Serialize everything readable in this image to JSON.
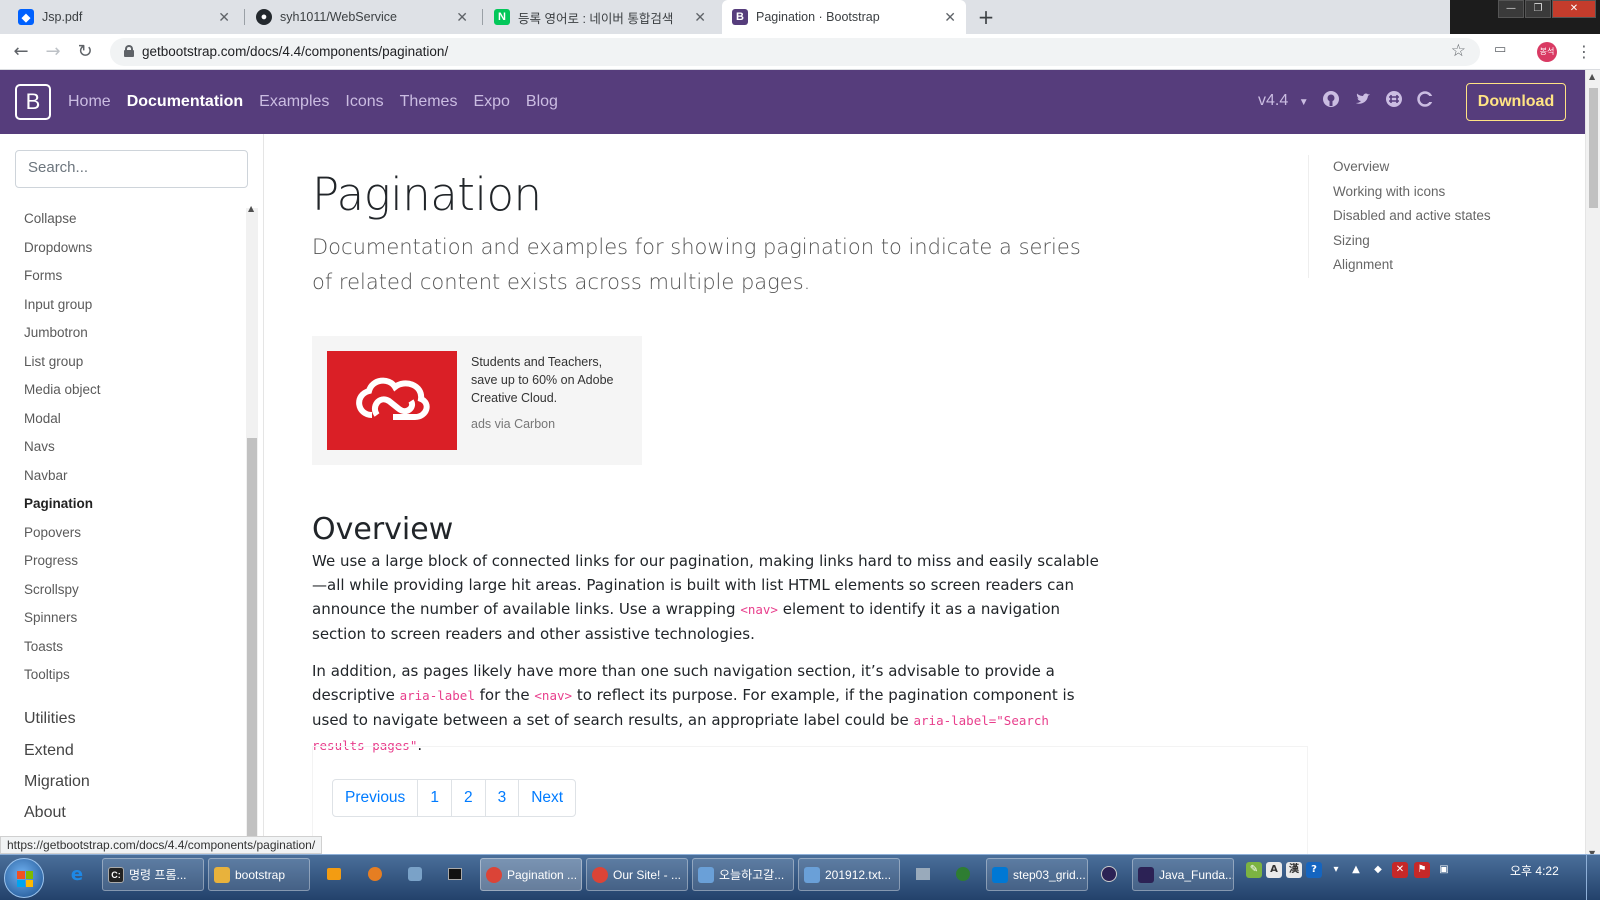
{
  "browser": {
    "tabs": [
      {
        "title": "Jsp.pdf",
        "icon": "dropbox-icon",
        "color": "#0061fe"
      },
      {
        "title": "syh1011/WebService",
        "icon": "github-icon",
        "color": "#24292e"
      },
      {
        "title": "등록 영어로 : 네이버 통합검색",
        "icon": "naver-icon",
        "color": "#03c75a"
      },
      {
        "title": "Pagination · Bootstrap",
        "icon": "bootstrap-icon",
        "color": "#563d7c"
      }
    ],
    "address": "getbootstrap.com/docs/4.4/components/pagination/",
    "profile_initials": "봉석",
    "status_url": "https://getbootstrap.com/docs/4.4/components/pagination/"
  },
  "header": {
    "brand": "B",
    "nav": [
      "Home",
      "Documentation",
      "Examples",
      "Icons",
      "Themes",
      "Expo",
      "Blog"
    ],
    "active_nav": "Documentation",
    "version": "v4.4",
    "download": "Download",
    "brand_color": "#563d7c",
    "download_color": "#ffe484"
  },
  "sidebar": {
    "search_placeholder": "Search...",
    "items": [
      "Collapse",
      "Dropdowns",
      "Forms",
      "Input group",
      "Jumbotron",
      "List group",
      "Media object",
      "Modal",
      "Navs",
      "Navbar",
      "Pagination",
      "Popovers",
      "Progress",
      "Scrollspy",
      "Spinners",
      "Toasts",
      "Tooltips"
    ],
    "active_item": "Pagination",
    "sections": [
      "Utilities",
      "Extend",
      "Migration",
      "About"
    ]
  },
  "main": {
    "title": "Pagination",
    "lead": "Documentation and examples for showing pagination to indicate a series of related content exists across multiple pages.",
    "ad": {
      "text": "Students and Teachers, save up to 60% on Adobe Creative Cloud.",
      "via": "ads via Carbon"
    },
    "overview_heading": "Overview",
    "p1": {
      "a": "We use a large block of connected links for our pagination, making links hard to miss and easily scalable—all while providing large hit areas. Pagination is built with list HTML elements so screen readers can announce the number of available links. Use a wrapping ",
      "code": "<nav>",
      "b": " element to identify it as a navigation section to screen readers and other assistive technologies."
    },
    "p2": {
      "a": "In addition, as pages likely have more than one such navigation section, it’s advisable to provide a descriptive ",
      "code1": "aria-label",
      "b": " for the ",
      "code2": "<nav>",
      "c": " to reflect its purpose. For example, if the pagination component is used to navigate between a set of search results, an appropriate label could be ",
      "code3": "aria-label=\"Search results pages\"",
      "d": "."
    },
    "pagination": [
      "Previous",
      "1",
      "2",
      "3",
      "Next"
    ]
  },
  "toc": [
    "Overview",
    "Working with icons",
    "Disabled and active states",
    "Sizing",
    "Alignment"
  ],
  "taskbar": {
    "items": [
      {
        "label": "명령 프롬...",
        "icon": "cmd-icon",
        "color": "#222"
      },
      {
        "label": "bootstrap",
        "icon": "folder-icon",
        "color": "#e8b23c"
      },
      {
        "label": "Pagination ...",
        "icon": "chrome-icon",
        "color": "#db4437"
      },
      {
        "label": "Our Site! - ...",
        "icon": "chrome-icon",
        "color": "#db4437"
      },
      {
        "label": "오늘하고갈...",
        "icon": "notepad-icon",
        "color": "#6aa0d8"
      },
      {
        "label": "201912.txt...",
        "icon": "notepad-icon",
        "color": "#6aa0d8"
      },
      {
        "label": "step03_grid...",
        "icon": "vscode-icon",
        "color": "#0078d4"
      },
      {
        "label": "Java_Funda...",
        "icon": "eclipse-icon",
        "color": "#2c2255"
      }
    ],
    "clock": "오후 4:22"
  }
}
